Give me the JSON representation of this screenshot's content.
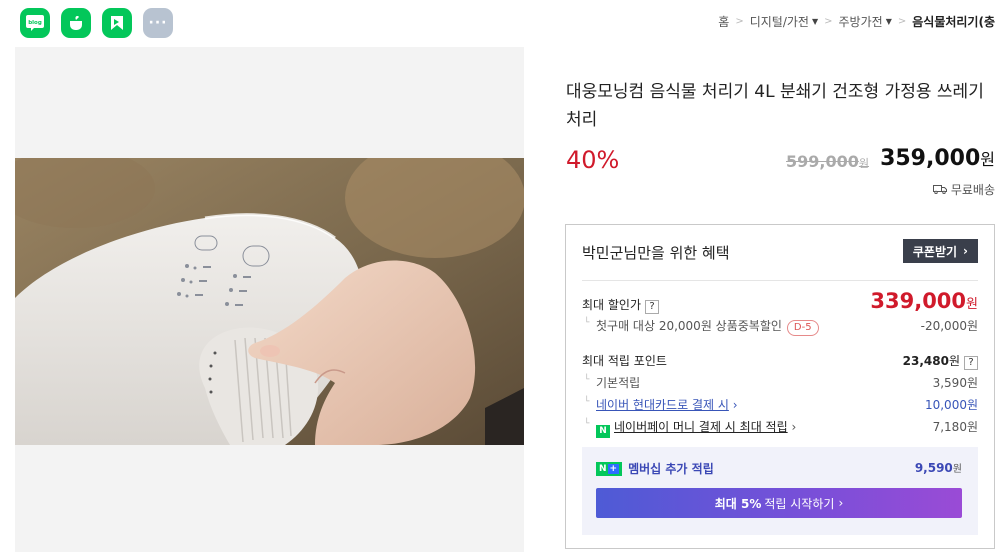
{
  "share": {
    "items": [
      {
        "name": "blog",
        "label": "blog"
      },
      {
        "name": "cafe",
        "label": ""
      },
      {
        "name": "band",
        "label": ""
      },
      {
        "name": "more",
        "label": "···"
      }
    ]
  },
  "breadcrumb": {
    "home": "홈",
    "cat1": "디지털/가전",
    "cat2": "주방가전",
    "cat3": "음식물처리기(충"
  },
  "product": {
    "title": "대웅모닝컴 음식물 처리기 4L 분쇄기 건조형 가정용 쓰레기 처리",
    "discount": "40%",
    "original_price": "599,000",
    "original_unit": "원",
    "price": "359,000",
    "price_unit": "원",
    "shipping": "무료배송"
  },
  "benefit": {
    "header": "박민군님만을 위한 혜택",
    "coupon_button": "쿠폰받기",
    "max_discount_label": "최대 할인가",
    "max_discount_value": "339,000",
    "max_discount_unit": "원",
    "first_purchase_label": "첫구매 대상 20,000원 상품중복할인",
    "first_purchase_badge": "D-5",
    "first_purchase_value": "-20,000원",
    "points_label": "최대 적립 포인트",
    "points_value": "23,480",
    "points_unit": "원",
    "basic_label": "기본적립",
    "basic_value": "3,590원",
    "card_label": "네이버 현대카드로 결제 시",
    "card_value": "10,000원",
    "npay_label": "네이버페이 머니 결제 시 최대 적립",
    "npay_value": "7,180원",
    "help_mark": "?",
    "member_label": "멤버십 추가 적립",
    "member_value": "9,590",
    "member_unit": "원",
    "cta_bold": "최대 5%",
    "cta_text": "적립 시작하기"
  },
  "colors": {
    "naver_green": "#03c75a",
    "discount_red": "#d01a2b",
    "link_blue": "#3855b8"
  }
}
